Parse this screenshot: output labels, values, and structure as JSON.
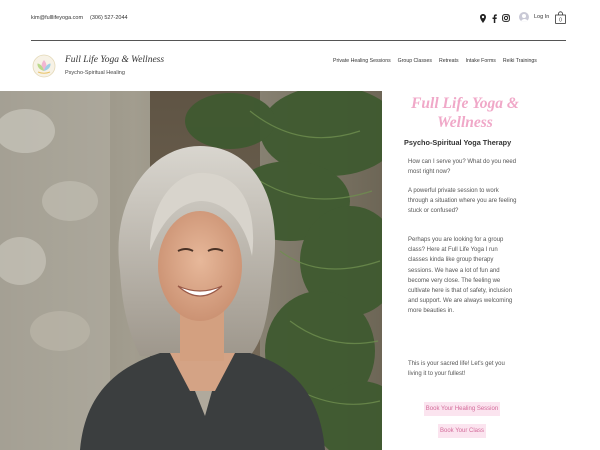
{
  "header": {
    "email": "kim@fulllifeyoga.com",
    "phone": "(306) 527-2044",
    "login_label": "Log In",
    "cart_count": "0",
    "social_icons": [
      "location-pin-icon",
      "facebook-icon",
      "instagram-icon"
    ]
  },
  "brand": {
    "title": "Full Life Yoga & Wellness",
    "subtitle": "Psycho-Spiritual Healing"
  },
  "nav": {
    "items": [
      {
        "label": "Private Healing Sessions"
      },
      {
        "label": "Group Classes"
      },
      {
        "label": "Retreats"
      },
      {
        "label": "Intake Forms"
      },
      {
        "label": "Reiki Trainings"
      }
    ]
  },
  "hero": {
    "title": "Full Life Yoga & Wellness",
    "subtitle": "Psycho-Spiritual Yoga Therapy",
    "paragraphs": [
      "How can I serve you? What do you need most right now?",
      "A powerful private session to work through a situation where you are feeling stuck or confused?",
      "Perhaps you are looking for a group class? Here at Full Life Yoga I run classes kinda like group therapy sessions. We have a lot of fun and become very close. The feeling we cultivate here is that of safety, inclusion and support. We are always welcoming more beauties in.",
      "This is your sacred life! Let's get you living it to your fullest!"
    ],
    "buttons": {
      "healing": "Book Your Healing Session",
      "class": "Book Your Class"
    }
  },
  "colors": {
    "accent_pink": "#f0a8c8",
    "button_bg": "#fbe4ef",
    "button_text": "#d36b9a"
  }
}
